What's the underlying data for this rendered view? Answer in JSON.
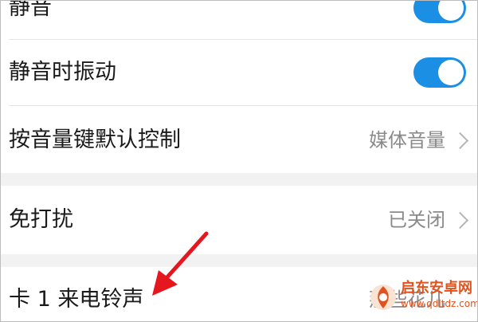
{
  "settings": {
    "mute": {
      "label": "静音",
      "on": true
    },
    "vibrate_on_mute": {
      "label": "静音时振动",
      "on": true
    },
    "volume_key": {
      "label": "按音量键默认控制",
      "value": "媒体音量"
    },
    "do_not_disturb": {
      "label": "免打扰",
      "value": "已关闭"
    },
    "sim1_ringtone": {
      "label": "卡 1 来电铃声",
      "value": "那些花儿"
    }
  },
  "colors": {
    "toggle_on": "#1a8fe3",
    "annotation_arrow": "#e5161e",
    "section_gap": "#f2f2f2"
  },
  "watermark": {
    "title": "启东安卓网",
    "url": "www.qdltdz.com"
  }
}
